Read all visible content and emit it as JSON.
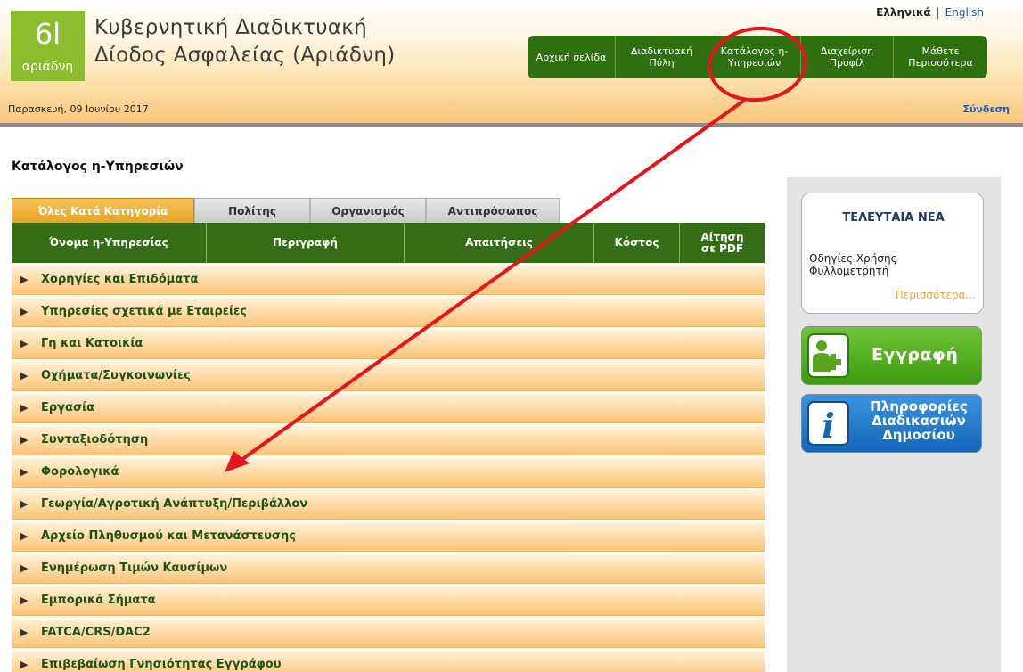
{
  "header": {
    "logo_glyph": "6l",
    "logo_word": "αριάδνη",
    "title_line1": "Κυβερνητική Διαδικτυακή",
    "title_line2": "Δίοδος Ασφαλείας (Αριάδνη)",
    "lang_active": "Ελληνικά",
    "lang_sep": "|",
    "lang_other": "English",
    "nav": [
      "Αρχική σελίδα",
      "Διαδικτυακή Πύλη",
      "Κατάλογος η-Υπηρεσιών",
      "Διαχείριση Προφίλ",
      "Μάθετε Περισσότερα"
    ],
    "date": "Παρασκευή, 09 Ιουνίου 2017",
    "login": "Σύνδεση"
  },
  "main": {
    "title": "Κατάλογος η-Υπηρεσιών",
    "tabs": [
      "Όλες Κατά Κατηγορία",
      "Πολίτης",
      "Οργανισμός",
      "Αντιπρόσωπος"
    ],
    "columns": [
      "Όνομα η-Υπηρεσίας",
      "Περιγραφή",
      "Απαιτήσεις",
      "Κόστος",
      "Αίτηση σε PDF"
    ],
    "categories": [
      "Χορηγίες και Επιδόματα",
      "Υπηρεσίες σχετικά με Εταιρείες",
      "Γη και Κατοικία",
      "Οχήματα/Συγκοινωνίες",
      "Εργασία",
      "Συνταξιοδότηση",
      "Φορολογικά",
      "Γεωργία/Αγροτική Ανάπτυξη/Περιβάλλον",
      "Αρχείο Πληθυσμού και Μετανάστευσης",
      "Ενημέρωση Τιμών Καυσίμων",
      "Εμπορικά Σήματα",
      "FATCA/CRS/DAC2",
      "Επιβεβαίωση Γνησιότητας Εγγράφου"
    ]
  },
  "sidebar": {
    "news_title": "ΤΕΛΕΥΤΑΙΑ ΝΕΑ",
    "news_item": "Οδηγίες Χρήσης Φυλλομετρητή",
    "news_more": "Περισσότερα...",
    "register_label": "Εγγραφή",
    "info_label": "Πληροφορίες Διαδικασιών Δημοσίου",
    "info_icon_letter": "i"
  },
  "colors": {
    "nav_green": "#2e6f0e",
    "table_header_green": "#356d17",
    "row_orange": "#fdd9a0",
    "tab_active_orange": "#e8a421",
    "annotation_red": "#e8141c"
  }
}
